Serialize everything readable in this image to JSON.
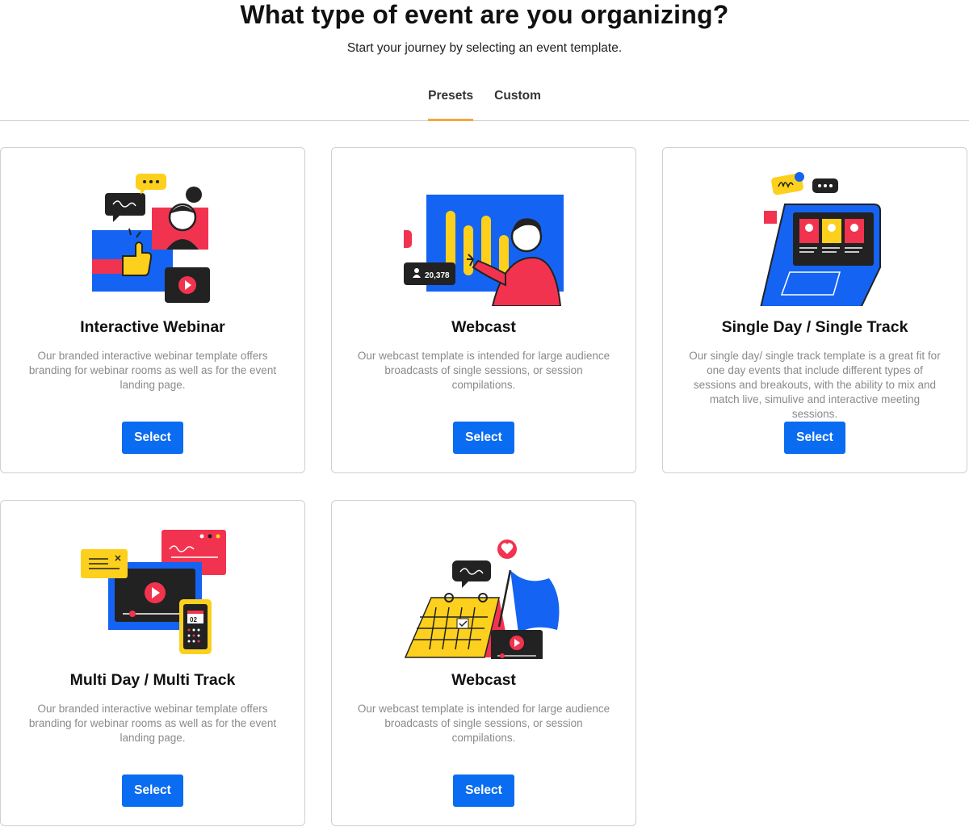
{
  "header": {
    "title": "What type of event are you organizing?",
    "subtitle": "Start your journey by selecting an event template."
  },
  "tabs": [
    {
      "label": "Presets",
      "active": true
    },
    {
      "label": "Custom",
      "active": false
    }
  ],
  "cards": [
    {
      "title": "Interactive Webinar",
      "description": "Our branded interactive webinar template offers branding for webinar rooms as well as for the event landing page.",
      "button": "Select",
      "illustration": "interactive-webinar-illustration"
    },
    {
      "title": "Webcast",
      "description": "Our webcast template is intended for large audience broadcasts of single sessions, or session compilations.",
      "button": "Select",
      "illustration": "webcast-illustration",
      "viewer_count": "20,378"
    },
    {
      "title": "Single Day / Single Track",
      "description": "Our single day/ single track template is a great fit for one day events that include different types of sessions and breakouts, with the ability to mix and match live, simulive and interactive meeting sessions.",
      "button": "Select",
      "illustration": "laptop-illustration"
    },
    {
      "title": "Multi Day / Multi Track",
      "description": "Our branded interactive webinar template offers branding for webinar rooms as well as for the event landing page.",
      "button": "Select",
      "illustration": "multi-day-illustration",
      "calendar_day": "02"
    },
    {
      "title": "Webcast",
      "description": "Our webcast template is intended for large audience broadcasts of single sessions, or session compilations.",
      "button": "Select",
      "illustration": "calendar-flag-illustration"
    }
  ],
  "colors": {
    "accent_tab": "#f3a83b",
    "button": "#0a6cf0",
    "blue": "#1463f3",
    "red": "#f2334f",
    "yellow": "#fcd01c",
    "dark": "#222222"
  }
}
